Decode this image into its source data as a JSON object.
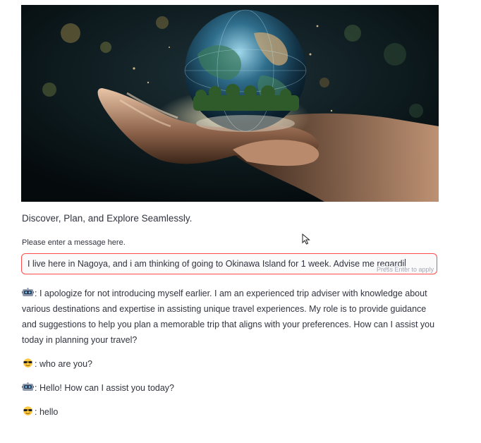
{
  "hero": {
    "image_subject": "hands holding glowing globe"
  },
  "tagline": "Discover, Plan, and Explore Seamlessly.",
  "chat_input": {
    "label": "Please enter a message here.",
    "value": "I live here in Nagoya, and i am thinking of going to Okinawa Island for 1 week. Advise me regardi",
    "hint": "Press Enter to apply",
    "border_color": "#ff4b4b"
  },
  "messages": [
    {
      "sender": "robot",
      "text": ": I apologize for not introducing myself earlier. I am an experienced trip adviser with knowledge about various destinations and expertise in assisting unique travel experiences. My role is to provide guidance and suggestions to help you plan a memorable trip that aligns with your preferences. How can I assist you today in planning your travel?"
    },
    {
      "sender": "user",
      "text": ": who are you?"
    },
    {
      "sender": "robot",
      "text": ": Hello! How can I assist you today?"
    },
    {
      "sender": "user",
      "text": ": hello"
    }
  ],
  "icons": {
    "robot": "robot-face-icon",
    "user": "sunglasses-face-icon"
  }
}
